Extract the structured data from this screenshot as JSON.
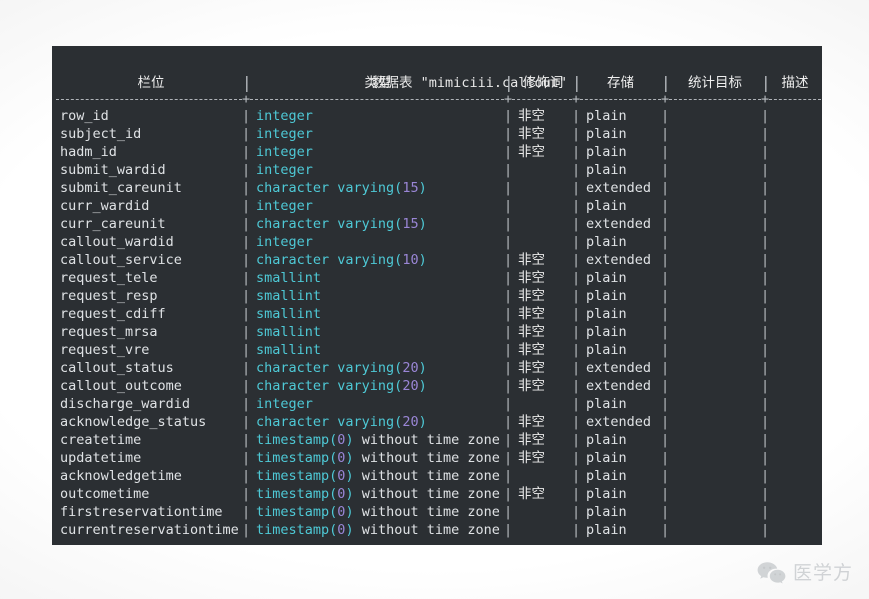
{
  "terminal": {
    "title_prefix": "数据表 ",
    "title_table": "\"mimiciii.callout\"",
    "title_full": "数据表 \"mimiciii.callout\"",
    "separator_glyph": "|",
    "junction_glyph": "+",
    "colors": {
      "background": "#2b2f33",
      "field_text": "#dfe2e5",
      "type_text": "#4ec9d6",
      "type_number": "#9a86d6",
      "plain_text": "#dfe2e5",
      "separator": "#b9bdc2",
      "page_background": "#ffffff"
    }
  },
  "table": {
    "headers": [
      {
        "label": "栏位"
      },
      {
        "label": "类型"
      },
      {
        "label": "修饰词"
      },
      {
        "label": "存储"
      },
      {
        "label": "统计目标"
      },
      {
        "label": "描述"
      }
    ],
    "not_null_label": "非空",
    "storage_plain": "plain",
    "storage_extended": "extended",
    "rows": [
      {
        "field": "row_id",
        "type_base": "integer",
        "type_num": "",
        "type_tail": "",
        "modifier": "非空",
        "storage": "plain",
        "stats": "",
        "description": ""
      },
      {
        "field": "subject_id",
        "type_base": "integer",
        "type_num": "",
        "type_tail": "",
        "modifier": "非空",
        "storage": "plain",
        "stats": "",
        "description": ""
      },
      {
        "field": "hadm_id",
        "type_base": "integer",
        "type_num": "",
        "type_tail": "",
        "modifier": "非空",
        "storage": "plain",
        "stats": "",
        "description": ""
      },
      {
        "field": "submit_wardid",
        "type_base": "integer",
        "type_num": "",
        "type_tail": "",
        "modifier": "",
        "storage": "plain",
        "stats": "",
        "description": ""
      },
      {
        "field": "submit_careunit",
        "type_base": "character varying",
        "type_num": "15",
        "type_tail": "",
        "modifier": "",
        "storage": "extended",
        "stats": "",
        "description": ""
      },
      {
        "field": "curr_wardid",
        "type_base": "integer",
        "type_num": "",
        "type_tail": "",
        "modifier": "",
        "storage": "plain",
        "stats": "",
        "description": ""
      },
      {
        "field": "curr_careunit",
        "type_base": "character varying",
        "type_num": "15",
        "type_tail": "",
        "modifier": "",
        "storage": "extended",
        "stats": "",
        "description": ""
      },
      {
        "field": "callout_wardid",
        "type_base": "integer",
        "type_num": "",
        "type_tail": "",
        "modifier": "",
        "storage": "plain",
        "stats": "",
        "description": ""
      },
      {
        "field": "callout_service",
        "type_base": "character varying",
        "type_num": "10",
        "type_tail": "",
        "modifier": "非空",
        "storage": "extended",
        "stats": "",
        "description": ""
      },
      {
        "field": "request_tele",
        "type_base": "smallint",
        "type_num": "",
        "type_tail": "",
        "modifier": "非空",
        "storage": "plain",
        "stats": "",
        "description": ""
      },
      {
        "field": "request_resp",
        "type_base": "smallint",
        "type_num": "",
        "type_tail": "",
        "modifier": "非空",
        "storage": "plain",
        "stats": "",
        "description": ""
      },
      {
        "field": "request_cdiff",
        "type_base": "smallint",
        "type_num": "",
        "type_tail": "",
        "modifier": "非空",
        "storage": "plain",
        "stats": "",
        "description": ""
      },
      {
        "field": "request_mrsa",
        "type_base": "smallint",
        "type_num": "",
        "type_tail": "",
        "modifier": "非空",
        "storage": "plain",
        "stats": "",
        "description": ""
      },
      {
        "field": "request_vre",
        "type_base": "smallint",
        "type_num": "",
        "type_tail": "",
        "modifier": "非空",
        "storage": "plain",
        "stats": "",
        "description": ""
      },
      {
        "field": "callout_status",
        "type_base": "character varying",
        "type_num": "20",
        "type_tail": "",
        "modifier": "非空",
        "storage": "extended",
        "stats": "",
        "description": ""
      },
      {
        "field": "callout_outcome",
        "type_base": "character varying",
        "type_num": "20",
        "type_tail": "",
        "modifier": "非空",
        "storage": "extended",
        "stats": "",
        "description": ""
      },
      {
        "field": "discharge_wardid",
        "type_base": "integer",
        "type_num": "",
        "type_tail": "",
        "modifier": "",
        "storage": "plain",
        "stats": "",
        "description": ""
      },
      {
        "field": "acknowledge_status",
        "type_base": "character varying",
        "type_num": "20",
        "type_tail": "",
        "modifier": "非空",
        "storage": "extended",
        "stats": "",
        "description": ""
      },
      {
        "field": "createtime",
        "type_base": "timestamp",
        "type_num": "0",
        "type_tail": " without time zone",
        "modifier": "非空",
        "storage": "plain",
        "stats": "",
        "description": ""
      },
      {
        "field": "updatetime",
        "type_base": "timestamp",
        "type_num": "0",
        "type_tail": " without time zone",
        "modifier": "非空",
        "storage": "plain",
        "stats": "",
        "description": ""
      },
      {
        "field": "acknowledgetime",
        "type_base": "timestamp",
        "type_num": "0",
        "type_tail": " without time zone",
        "modifier": "",
        "storage": "plain",
        "stats": "",
        "description": ""
      },
      {
        "field": "outcometime",
        "type_base": "timestamp",
        "type_num": "0",
        "type_tail": " without time zone",
        "modifier": "非空",
        "storage": "plain",
        "stats": "",
        "description": ""
      },
      {
        "field": "firstreservationtime",
        "type_base": "timestamp",
        "type_num": "0",
        "type_tail": " without time zone",
        "modifier": "",
        "storage": "plain",
        "stats": "",
        "description": ""
      },
      {
        "field": "currentreservationtime",
        "type_base": "timestamp",
        "type_num": "0",
        "type_tail": " without time zone",
        "modifier": "",
        "storage": "plain",
        "stats": "",
        "description": ""
      }
    ]
  },
  "watermark": {
    "text": "医学方",
    "icon": "wechat-icon"
  }
}
